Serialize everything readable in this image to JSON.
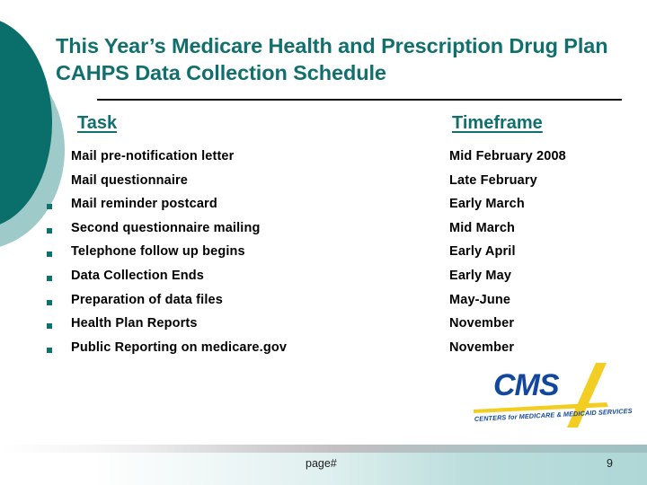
{
  "slide": {
    "title": "This Year’s Medicare Health and Prescription Drug Plan CAHPS Data Collection Schedule",
    "accent_color": "#11706E",
    "circle_dark_color": "#0A6E6B",
    "circle_light_color": "#9ECBCA"
  },
  "table": {
    "headers": {
      "task": "Task",
      "timeframe": "Timeframe"
    },
    "rows": [
      {
        "task": "Mail pre-notification letter",
        "timeframe": "Mid February 2008",
        "bullet_visible": false
      },
      {
        "task": "Mail questionnaire",
        "timeframe": "Late February",
        "bullet_visible": false
      },
      {
        "task": "Mail reminder postcard",
        "timeframe": "Early March",
        "bullet_visible": true
      },
      {
        "task": "Second questionnaire mailing",
        "timeframe": "Mid March",
        "bullet_visible": true
      },
      {
        "task": "Telephone follow up begins",
        "timeframe": "Early April",
        "bullet_visible": true
      },
      {
        "task": "Data Collection Ends",
        "timeframe": "Early May",
        "bullet_visible": true
      },
      {
        "task": "Preparation of data files",
        "timeframe": "May-June",
        "bullet_visible": true
      },
      {
        "task": "Health Plan Reports",
        "timeframe": "November",
        "bullet_visible": true
      },
      {
        "task": "Public Reporting on medicare.gov",
        "timeframe": "November",
        "bullet_visible": true
      }
    ]
  },
  "logo": {
    "mark": "CMS",
    "tagline": "CENTERS for MEDICARE & MEDICAID SERVICES",
    "mark_color": "#12479E",
    "slash_color": "#F3CE22"
  },
  "footer": {
    "page_label": "page#",
    "page_number": "9"
  }
}
